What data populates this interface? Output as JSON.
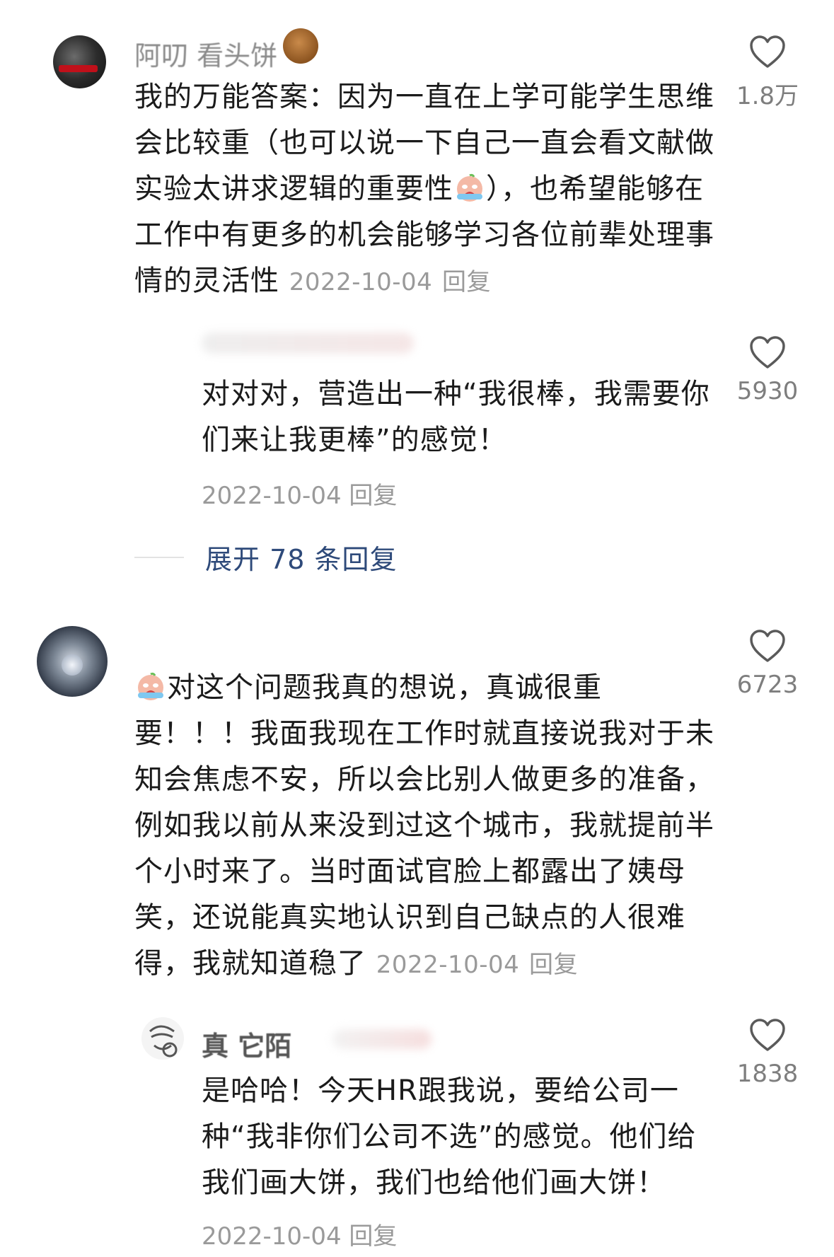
{
  "comments": [
    {
      "username": "阿叨 看头饼",
      "text": "我的万能答案：因为一直在上学可能学生思维会比较重（也可以说一下自己一直会看文献做实验太讲求逻辑的重要性",
      "text_after": "），也希望能够在工作中有更多的机会能够学习各位前辈处理事情的灵活性",
      "date": "2022-10-04",
      "reply_label": "回复",
      "likes": "1.8万"
    },
    {
      "text": "对对对，营造出一种“我很棒，我需要你们来让我更棒”的感觉！",
      "date": "2022-10-04",
      "reply_label": "回复",
      "likes": "5930"
    },
    {
      "text": "对这个问题我真的想说，真诚很重要！！！我面我现在工作时就直接说我对于未知会焦虑不安，所以会比别人做更多的准备，例如我以前从来没到过这个城市，我就提前半个小时来了。当时面试官脸上都露出了姨母笑，还说能真实地认识到自己缺点的人很难得，我就知道稳了",
      "date": "2022-10-04",
      "reply_label": "回复",
      "likes": "6723"
    },
    {
      "username": "真 它陌",
      "text": "是哈哈！今天HR跟我说，要给公司一种“我非你们公司不选”的感觉。他们给我们画大饼，我们也给他们画大饼！",
      "date": "2022-10-04",
      "reply_label": "回复",
      "likes": "1838"
    }
  ],
  "expand": {
    "label": "展开 78 条回复"
  },
  "icons": {
    "like": "heart-outline-icon",
    "emoji": "crying-face-emoji-icon"
  },
  "colors": {
    "link": "#2e4a7a",
    "meta": "#9a9a9a",
    "text": "#1b1b1b"
  }
}
